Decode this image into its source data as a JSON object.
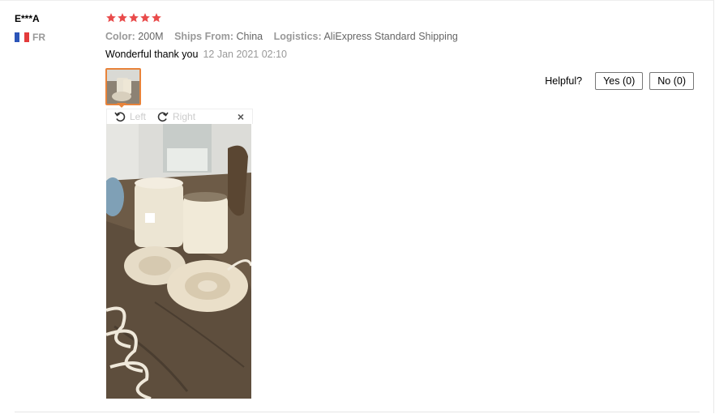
{
  "review": {
    "user": "E***A",
    "country_code": "FR",
    "rating": 5,
    "star_color": "#e94b4b",
    "meta": [
      {
        "key": "Color:",
        "value": "200M"
      },
      {
        "key": "Ships From:",
        "value": "China"
      },
      {
        "key": "Logistics:",
        "value": "AliExpress Standard Shipping"
      }
    ],
    "text": "Wonderful thank you",
    "date": "12 Jan 2021 02:10"
  },
  "helpful": {
    "label": "Helpful?",
    "yes": "Yes (0)",
    "no": "No (0)"
  },
  "viewer": {
    "rotate_left": "Left",
    "rotate_right": "Right",
    "close": "×"
  },
  "colors": {
    "accent": "#e8833a",
    "flag_blue": "#2c55b8",
    "flag_white": "#ffffff",
    "flag_red": "#e33b3b"
  }
}
